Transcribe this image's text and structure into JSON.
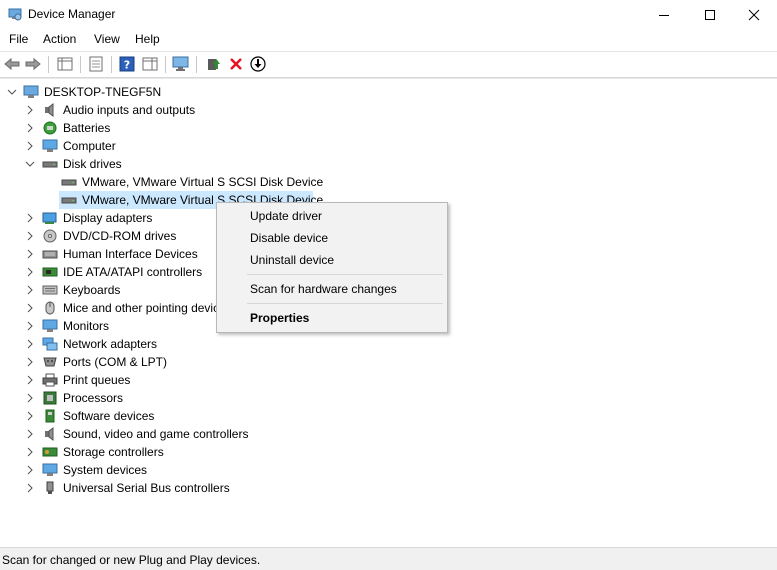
{
  "window": {
    "title": "Device Manager",
    "icon": "device-manager-icon"
  },
  "menubar": {
    "file": "File",
    "action": "Action",
    "view": "View",
    "help": "Help"
  },
  "tree": {
    "root": "DESKTOP-TNEGF5N",
    "categories": [
      {
        "label": "Audio inputs and outputs",
        "icon": "speaker-icon"
      },
      {
        "label": "Batteries",
        "icon": "battery-icon"
      },
      {
        "label": "Computer",
        "icon": "monitor-icon"
      },
      {
        "label": "Disk drives",
        "icon": "disk-drive-icon",
        "children": [
          "VMware, VMware Virtual S SCSI Disk Device",
          "VMware, VMware Virtual S SCSI Disk Device"
        ]
      },
      {
        "label": "Display adapters",
        "icon": "display-adapter-icon"
      },
      {
        "label": "DVD/CD-ROM drives",
        "icon": "dvd-icon"
      },
      {
        "label": "Human Interface Devices",
        "icon": "hid-icon"
      },
      {
        "label": "IDE ATA/ATAPI controllers",
        "icon": "ide-controller-icon"
      },
      {
        "label": "Keyboards",
        "icon": "keyboard-icon"
      },
      {
        "label": "Mice and other pointing devices",
        "icon": "mouse-icon"
      },
      {
        "label": "Monitors",
        "icon": "monitor-icon"
      },
      {
        "label": "Network adapters",
        "icon": "network-icon"
      },
      {
        "label": "Ports (COM & LPT)",
        "icon": "port-icon"
      },
      {
        "label": "Print queues",
        "icon": "printer-icon"
      },
      {
        "label": "Processors",
        "icon": "processor-icon"
      },
      {
        "label": "Software devices",
        "icon": "software-device-icon"
      },
      {
        "label": "Sound, video and game controllers",
        "icon": "speaker-icon"
      },
      {
        "label": "Storage controllers",
        "icon": "storage-controller-icon"
      },
      {
        "label": "System devices",
        "icon": "system-device-icon"
      },
      {
        "label": "Universal Serial Bus controllers",
        "icon": "usb-icon"
      }
    ]
  },
  "context_menu": {
    "update_driver": "Update driver",
    "disable_device": "Disable device",
    "uninstall_device": "Uninstall device",
    "scan_hardware": "Scan for hardware changes",
    "properties": "Properties"
  },
  "statusbar": {
    "text": "Scan for changed or new Plug and Play devices."
  },
  "colors": {
    "selection": "#cce8ff",
    "menu_bg": "#f2f2f2",
    "uninstall_red": "#e81123",
    "update_green": "#2e8b2e"
  }
}
